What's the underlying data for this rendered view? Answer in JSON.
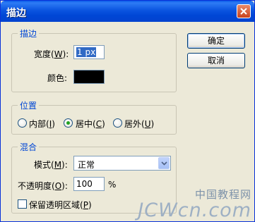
{
  "window": {
    "title": "描边"
  },
  "stroke_group": {
    "label": "描边",
    "width_label": "宽度(",
    "width_mnemonic": "W",
    "width_label_end": "):",
    "width_value": "1 px",
    "color_label": "颜色:",
    "color_value": "#000000"
  },
  "position_group": {
    "label": "位置",
    "options": [
      {
        "label": "内部(",
        "mnemonic": "I",
        "end": ")",
        "selected": false
      },
      {
        "label": "居中(",
        "mnemonic": "C",
        "end": ")",
        "selected": true
      },
      {
        "label": "居外(",
        "mnemonic": "U",
        "end": ")",
        "selected": false
      }
    ]
  },
  "blend_group": {
    "label": "混合",
    "mode_label": "模式(",
    "mode_mnemonic": "M",
    "mode_label_end": "):",
    "mode_value": "正常",
    "opacity_label": "不透明度(",
    "opacity_mnemonic": "O",
    "opacity_label_end": "):",
    "opacity_value": "100",
    "opacity_unit": "%",
    "preserve_label": "保留透明区域(",
    "preserve_mnemonic": "P",
    "preserve_label_end": ")",
    "preserve_checked": false
  },
  "buttons": {
    "ok": "确定",
    "cancel": "取消"
  },
  "watermark": {
    "cn": "中国教程网",
    "url": "JCWcn.com"
  },
  "colors": {
    "title_bar": "#0054e3",
    "accent_label": "#0046d5",
    "radio_dot": "#21a121"
  }
}
